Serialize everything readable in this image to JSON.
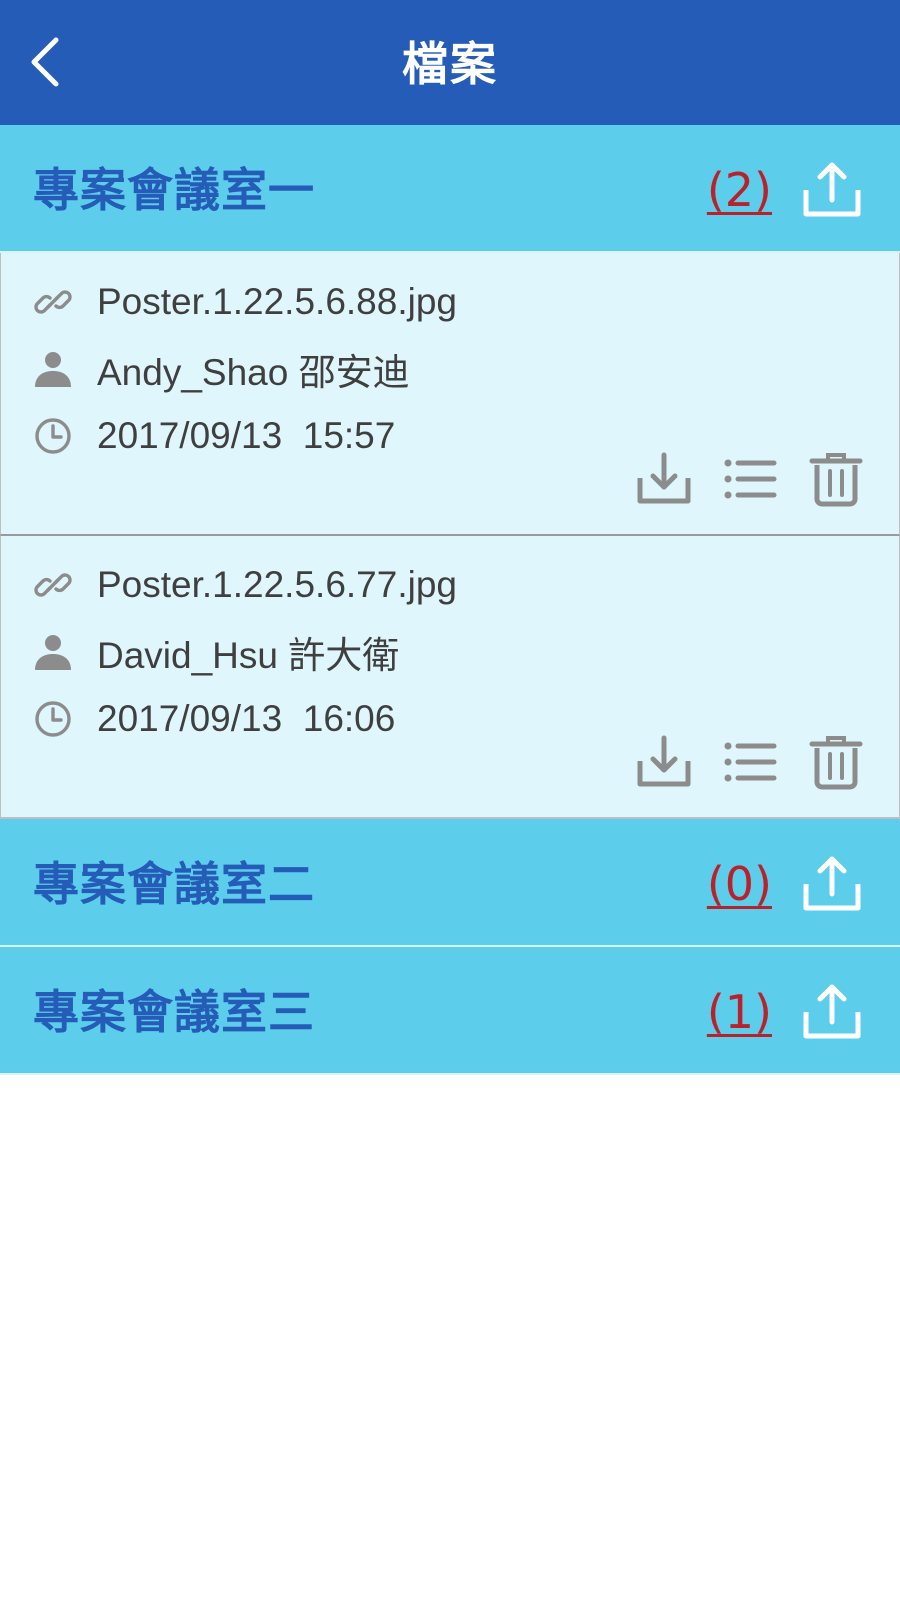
{
  "header": {
    "title": "檔案",
    "back_icon": "chevron-left-icon"
  },
  "colors": {
    "app_bar": "#245cb8",
    "room_header_bg": "#5dcdec",
    "room_name": "#245cb8",
    "count": "#b8232b",
    "file_bg": "#dff6fc",
    "icon_gray": "#8c8c8c"
  },
  "rooms": [
    {
      "name": "專案會議室一",
      "count": "(2)",
      "upload_icon": "upload-icon",
      "files": [
        {
          "filename": "Poster.1.22.5.6.88.jpg",
          "uploader": "Andy_Shao 邵安迪",
          "datetime": "2017/09/13  15:57"
        },
        {
          "filename": "Poster.1.22.5.6.77.jpg",
          "uploader": "David_Hsu 許大衛",
          "datetime": "2017/09/13  16:06"
        }
      ]
    },
    {
      "name": "專案會議室二",
      "count": "(0)",
      "upload_icon": "upload-icon",
      "files": []
    },
    {
      "name": "專案會議室三",
      "count": "(1)",
      "upload_icon": "upload-icon",
      "files": []
    }
  ],
  "file_actions": [
    "download-icon",
    "list-icon",
    "trash-icon"
  ]
}
